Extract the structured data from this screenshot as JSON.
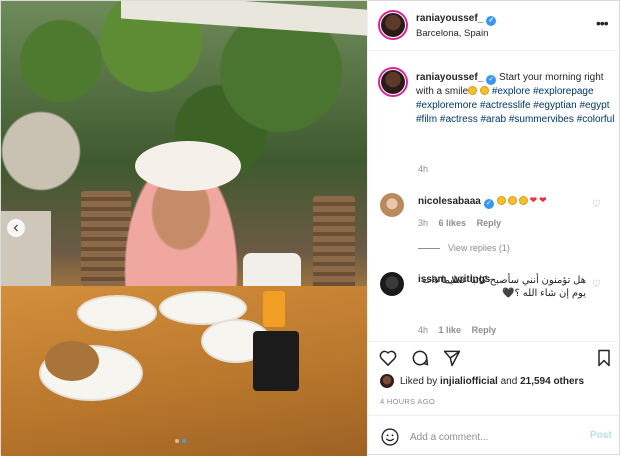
{
  "post": {
    "username": "raniayoussef_",
    "location": "Barcelona, Spain",
    "more_icon": "more-horizontal-icon"
  },
  "caption": {
    "username": "raniayoussef_",
    "text_before": "Start your morning right with a smile",
    "hashtags": [
      "#explore",
      "#explorepage",
      "#exploremore",
      "#actresslife",
      "#egyptian",
      "#egypt",
      "#film",
      "#actress",
      "#arab",
      "#summervibes",
      "#colorful"
    ],
    "time": "4h"
  },
  "comments": [
    {
      "username": "nicolesabaaa",
      "verified": true,
      "time": "3h",
      "likes": "6 likes",
      "reply": "Reply",
      "view_replies": "View replies (1)"
    },
    {
      "username": "issam_writings",
      "text": "هل تؤمنون أنني سأصبح كاتبا عظيما ذات يوم إن شاء الله ؟🖤",
      "time": "4h",
      "likes": "1 like",
      "reply": "Reply"
    }
  ],
  "actions": {
    "like_icon": "heart-icon",
    "comment_icon": "comment-icon",
    "share_icon": "paper-plane-icon",
    "save_icon": "bookmark-icon"
  },
  "liked_by": {
    "prefix": "Liked by",
    "user": "injialiofficial",
    "and": "and",
    "others": "21,594 others"
  },
  "time_ago": "4 HOURS AGO",
  "comment_box": {
    "placeholder": "Add a comment...",
    "post_label": "Post"
  },
  "carousel": {
    "prev_icon": "chevron-left-icon",
    "dots": 2,
    "active_dot": 1
  },
  "colors": {
    "hashtag": "#00376b",
    "verified": "#3897f0",
    "post_button": "#b2dffc",
    "muted": "#8e8e8e"
  }
}
